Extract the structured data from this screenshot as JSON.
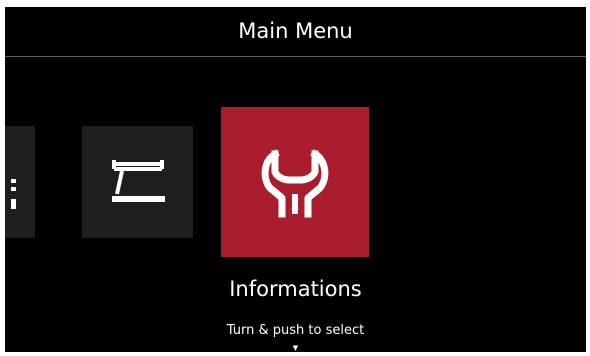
{
  "header": {
    "title": "Main Menu"
  },
  "menu": {
    "items": [
      {
        "icon": "list-icon"
      },
      {
        "icon": "welding-torch-icon"
      },
      {
        "icon": "wrench-icon",
        "label": "Informations",
        "selected": true
      }
    ],
    "selected_label": "Informations"
  },
  "footer": {
    "hint": "Turn & push to select",
    "arrow": "▼"
  },
  "colors": {
    "background": "#000000",
    "tile": "#1e1e1e",
    "selected_tile": "#a91d2e",
    "text": "#ffffff"
  }
}
